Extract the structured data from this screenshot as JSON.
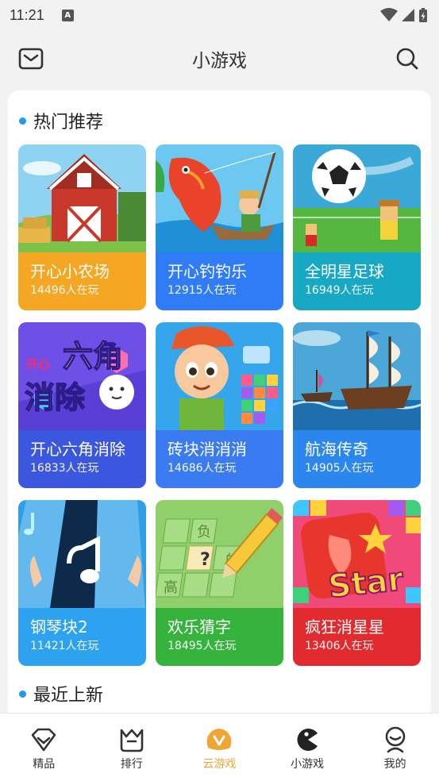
{
  "status_bar": {
    "time": "11:21",
    "notification_badge": "A"
  },
  "header": {
    "title": "小游戏",
    "mail_icon": "mail-icon",
    "search_icon": "search-icon"
  },
  "sections": {
    "hot": "热门推荐",
    "recent": "最近上新"
  },
  "games": [
    {
      "name": "开心小农场",
      "players": "14496人在玩",
      "color": "#f5a623",
      "art": "farm-barn"
    },
    {
      "name": "开心钓钓乐",
      "players": "12915人在玩",
      "color": "#2f7cf6",
      "art": "fishing"
    },
    {
      "name": "全明星足球",
      "players": "16949人在玩",
      "color": "#17a8c6",
      "art": "soccer"
    },
    {
      "name": "开心六角消除",
      "players": "16833人在玩",
      "color": "#3b57e0",
      "art": "hexagon-match"
    },
    {
      "name": "砖块消消消",
      "players": "14686人在玩",
      "color": "#3a7bf2",
      "art": "block-match"
    },
    {
      "name": "航海传奇",
      "players": "14905人在玩",
      "color": "#2b86ee",
      "art": "sailing-ship"
    },
    {
      "name": "钢琴块2",
      "players": "11421人在玩",
      "color": "#2da3f0",
      "art": "piano-tiles"
    },
    {
      "name": "欢乐猜字",
      "players": "18495人在玩",
      "color": "#36b33d",
      "art": "word-guess"
    },
    {
      "name": "疯狂消星星",
      "players": "13406人在玩",
      "color": "#e12b2f",
      "art": "pop-star"
    }
  ],
  "art_text": {
    "hexagon_line1": "开心",
    "hexagon_line2": "六角",
    "hexagon_line3": "消除",
    "star_word": "Star",
    "word_chars": [
      "负",
      "?",
      "的",
      "高"
    ]
  },
  "tabs": [
    {
      "label": "精品",
      "icon": "diamond-icon",
      "active": false
    },
    {
      "label": "排行",
      "icon": "crown-cup-icon",
      "active": false
    },
    {
      "label": "云游戏",
      "icon": "cloud-game-icon",
      "active": true
    },
    {
      "label": "小游戏",
      "icon": "pacman-icon",
      "active": false
    },
    {
      "label": "我的",
      "icon": "profile-icon",
      "active": false
    }
  ],
  "colors": {
    "accent": "#f0a634",
    "dot": "#1e9bf0"
  }
}
